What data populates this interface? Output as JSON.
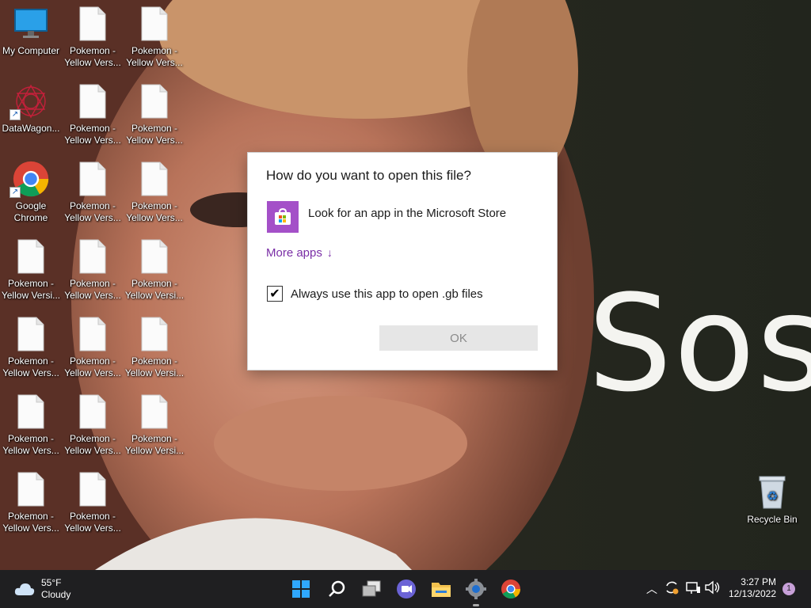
{
  "desktop": {
    "icons": [
      {
        "label": "My Computer",
        "icon": "monitor-icon"
      },
      {
        "label": "DataWagon...",
        "icon": "datawagon-icon",
        "shortcut": true
      },
      {
        "label": "Google Chrome",
        "icon": "chrome-icon",
        "shortcut": true
      },
      {
        "label": "Pokemon - Yellow Versi...",
        "icon": "file-icon"
      },
      {
        "label": "Pokemon - Yellow Vers...",
        "icon": "file-icon"
      },
      {
        "label": "Pokemon - Yellow Vers...",
        "icon": "file-icon"
      },
      {
        "label": "Pokemon - Yellow Vers...",
        "icon": "file-icon"
      },
      {
        "label": "Pokemon - Yellow Vers...",
        "icon": "file-icon"
      },
      {
        "label": "Pokemon - Yellow Vers...",
        "icon": "file-icon"
      },
      {
        "label": "Pokemon - Yellow Vers...",
        "icon": "file-icon"
      },
      {
        "label": "Pokemon - Yellow Vers...",
        "icon": "file-icon"
      },
      {
        "label": "Pokemon - Yellow Vers...",
        "icon": "file-icon"
      },
      {
        "label": "Pokemon - Yellow Vers...",
        "icon": "file-icon"
      },
      {
        "label": "Pokemon - Yellow Vers...",
        "icon": "file-icon"
      },
      {
        "label": "Pokemon - Yellow Vers...",
        "icon": "file-icon"
      },
      {
        "label": "Pokemon - Yellow Vers...",
        "icon": "file-icon"
      },
      {
        "label": "Pokemon - Yellow Vers...",
        "icon": "file-icon"
      },
      {
        "label": "Pokemon - Yellow Versi...",
        "icon": "file-icon"
      },
      {
        "label": "Pokemon - Yellow Versi...",
        "icon": "file-icon"
      },
      {
        "label": "Pokemon - Yellow Versi...",
        "icon": "file-icon"
      }
    ],
    "recycle_bin": "Recycle Bin",
    "wallpaper_text": "Sos"
  },
  "dialog": {
    "title": "How do you want to open this file?",
    "store_option": "Look for an app in the Microsoft Store",
    "more_apps": "More apps",
    "more_apps_arrow": "↓",
    "always_use": "Always use this app to open .gb files",
    "always_use_checked": true,
    "ok_label": "OK"
  },
  "taskbar": {
    "weather_temp": "55°F",
    "weather_desc": "Cloudy",
    "apps": [
      "start-icon",
      "search-icon",
      "task-view-icon",
      "teams-chat-icon",
      "file-explorer-icon",
      "settings-icon",
      "chrome-icon"
    ],
    "time": "3:27 PM",
    "date": "12/13/2022",
    "notification_count": "1"
  },
  "colors": {
    "accent": "#7a2ea6",
    "store_tile": "#a450c8",
    "taskbar": "#1f1f21"
  }
}
